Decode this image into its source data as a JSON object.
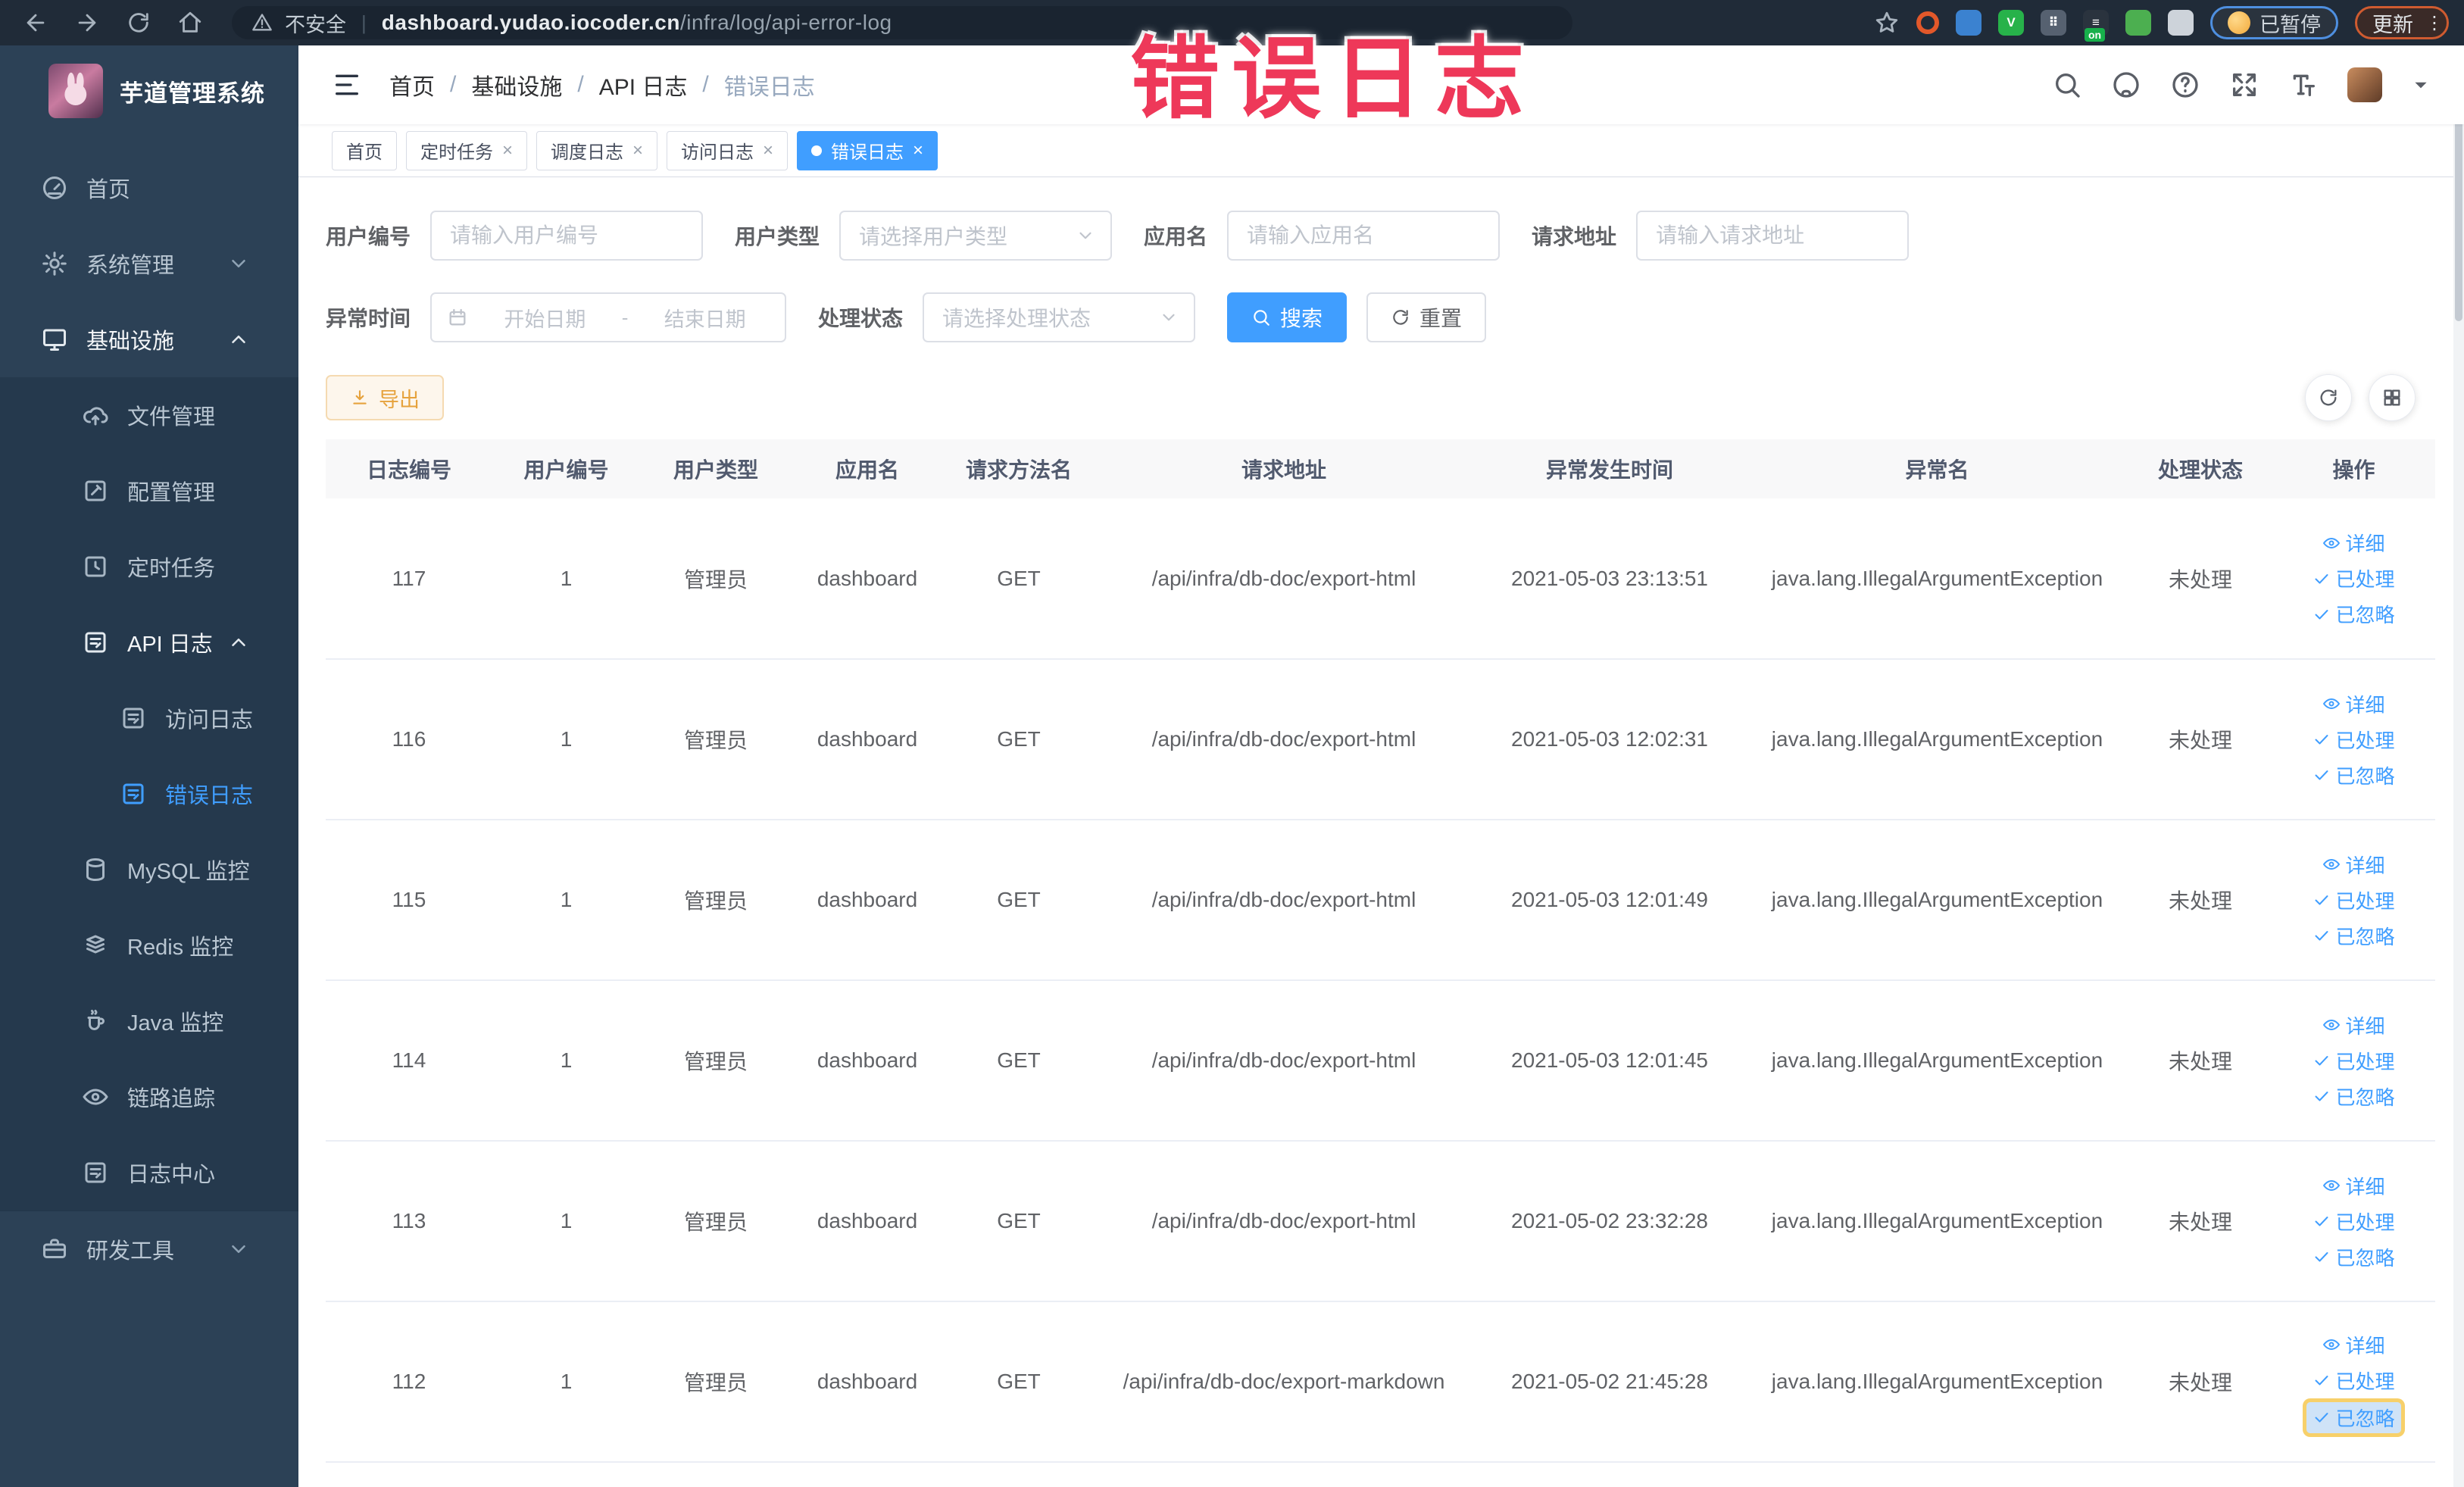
{
  "colors": {
    "accent": "#409eff",
    "warning": "#e6a23c",
    "annotation": "#ee3859",
    "sidebar_bg": "#2c4156",
    "submenu_bg": "#25394d",
    "chrome_bg": "#202b38"
  },
  "annotation": {
    "text": "错误日志"
  },
  "chrome": {
    "nav_icons": [
      "back",
      "forward",
      "reload",
      "home"
    ],
    "security_label": "不安全",
    "url_domain": "dashboard.yudao.iocoder.cn",
    "url_path": "/infra/log/api-error-log",
    "extensions": [
      {
        "id": "adblock",
        "color": "#e2582a",
        "style": "ring"
      },
      {
        "id": "shield",
        "color": "#3b82d0",
        "style": "solid",
        "text": ""
      },
      {
        "id": "v-green",
        "color": "#27b24a",
        "style": "solid",
        "text": "V"
      },
      {
        "id": "grid-apps",
        "color": "#566170",
        "style": "solid",
        "text": "⠿"
      },
      {
        "id": "switch-on",
        "color": "#2a333e",
        "style": "solid",
        "text": "≡",
        "badge": "on"
      },
      {
        "id": "leaf",
        "color": "#4caf50",
        "style": "solid",
        "text": ""
      },
      {
        "id": "puzzle",
        "color": "#cdd3da",
        "style": "solid",
        "text": ""
      }
    ],
    "profile_chip_label": "已暂停",
    "update_chip_label": "更新"
  },
  "sidebar": {
    "title": "芋道管理系统",
    "items": [
      {
        "id": "home",
        "label": "首页",
        "icon": "gauge",
        "level": 1
      },
      {
        "id": "system",
        "label": "系统管理",
        "icon": "gear",
        "level": 1,
        "chevron": "down"
      },
      {
        "id": "infra",
        "label": "基础设施",
        "icon": "monitor",
        "level": 1,
        "chevron": "up",
        "active": true
      },
      {
        "id": "file",
        "label": "文件管理",
        "icon": "cloud-upload",
        "level": 2,
        "sub": true
      },
      {
        "id": "config",
        "label": "配置管理",
        "icon": "edit-square",
        "level": 2,
        "sub": true
      },
      {
        "id": "job",
        "label": "定时任务",
        "icon": "timer",
        "level": 2,
        "sub": true
      },
      {
        "id": "api-log",
        "label": "API 日志",
        "icon": "doc-log",
        "level": 2,
        "sub": true,
        "chevron": "up",
        "active": true
      },
      {
        "id": "access-log",
        "label": "访问日志",
        "icon": "doc-log",
        "level": 3,
        "sub": true
      },
      {
        "id": "error-log",
        "label": "错误日志",
        "icon": "doc-log",
        "level": 3,
        "sub": true,
        "selected": true
      },
      {
        "id": "mysql",
        "label": "MySQL 监控",
        "icon": "mysql",
        "level": 2,
        "sub": true
      },
      {
        "id": "redis",
        "label": "Redis 监控",
        "icon": "redis",
        "level": 2,
        "sub": true
      },
      {
        "id": "java",
        "label": "Java 监控",
        "icon": "java",
        "level": 2,
        "sub": true
      },
      {
        "id": "trace",
        "label": "链路追踪",
        "icon": "eye",
        "level": 2,
        "sub": true
      },
      {
        "id": "log-center",
        "label": "日志中心",
        "icon": "doc-log",
        "level": 2,
        "sub": true
      },
      {
        "id": "dev-tools",
        "label": "研发工具",
        "icon": "toolbox",
        "level": 1,
        "chevron": "down",
        "bottom": true
      }
    ]
  },
  "navbar": {
    "breadcrumb": [
      "首页",
      "基础设施",
      "API 日志",
      "错误日志"
    ],
    "tools": [
      "search",
      "github",
      "question",
      "fullscreen",
      "font-size"
    ]
  },
  "tabs": [
    {
      "label": "首页",
      "closable": false
    },
    {
      "label": "定时任务",
      "closable": true
    },
    {
      "label": "调度日志",
      "closable": true
    },
    {
      "label": "访问日志",
      "closable": true
    },
    {
      "label": "错误日志",
      "closable": true,
      "active": true
    }
  ],
  "filters": {
    "user_id": {
      "label": "用户编号",
      "placeholder": "请输入用户编号"
    },
    "user_type": {
      "label": "用户类型",
      "placeholder": "请选择用户类型"
    },
    "app_name": {
      "label": "应用名",
      "placeholder": "请输入应用名"
    },
    "request_url": {
      "label": "请求地址",
      "placeholder": "请输入请求地址"
    },
    "exception_time": {
      "label": "异常时间",
      "start_placeholder": "开始日期",
      "separator": "-",
      "end_placeholder": "结束日期"
    },
    "process_status": {
      "label": "处理状态",
      "placeholder": "请选择处理状态"
    },
    "search_label": "搜索",
    "reset_label": "重置"
  },
  "toolbar": {
    "export_label": "导出"
  },
  "table": {
    "columns": [
      "日志编号",
      "用户编号",
      "用户类型",
      "应用名",
      "请求方法名",
      "请求地址",
      "异常发生时间",
      "异常名",
      "处理状态",
      "操作"
    ],
    "row_actions": [
      {
        "label": "详细",
        "icon": "eye"
      },
      {
        "label": "已处理",
        "icon": "check"
      },
      {
        "label": "已忽略",
        "icon": "check"
      }
    ],
    "rows": [
      {
        "id": "117",
        "user_id": "1",
        "user_type": "管理员",
        "app": "dashboard",
        "method": "GET",
        "url": "/api/infra/db-doc/export-html",
        "time": "2021-05-03 23:13:51",
        "exception": "java.lang.IllegalArgumentException",
        "status": "未处理"
      },
      {
        "id": "116",
        "user_id": "1",
        "user_type": "管理员",
        "app": "dashboard",
        "method": "GET",
        "url": "/api/infra/db-doc/export-html",
        "time": "2021-05-03 12:02:31",
        "exception": "java.lang.IllegalArgumentException",
        "status": "未处理"
      },
      {
        "id": "115",
        "user_id": "1",
        "user_type": "管理员",
        "app": "dashboard",
        "method": "GET",
        "url": "/api/infra/db-doc/export-html",
        "time": "2021-05-03 12:01:49",
        "exception": "java.lang.IllegalArgumentException",
        "status": "未处理"
      },
      {
        "id": "114",
        "user_id": "1",
        "user_type": "管理员",
        "app": "dashboard",
        "method": "GET",
        "url": "/api/infra/db-doc/export-html",
        "time": "2021-05-03 12:01:45",
        "exception": "java.lang.IllegalArgumentException",
        "status": "未处理"
      },
      {
        "id": "113",
        "user_id": "1",
        "user_type": "管理员",
        "app": "dashboard",
        "method": "GET",
        "url": "/api/infra/db-doc/export-html",
        "time": "2021-05-02 23:32:28",
        "exception": "java.lang.IllegalArgumentException",
        "status": "未处理"
      },
      {
        "id": "112",
        "user_id": "1",
        "user_type": "管理员",
        "app": "dashboard",
        "method": "GET",
        "url": "/api/infra/db-doc/export-markdown",
        "time": "2021-05-02 21:45:28",
        "exception": "java.lang.IllegalArgumentException",
        "status": "未处理",
        "highlight_ignore": true
      }
    ]
  }
}
